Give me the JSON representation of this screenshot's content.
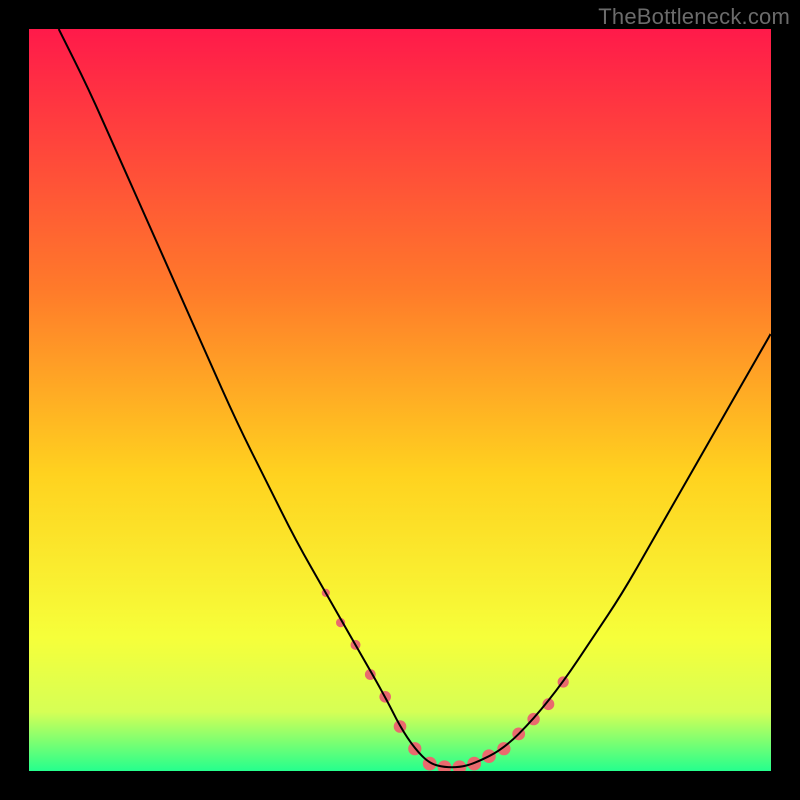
{
  "watermark": "TheBottleneck.com",
  "chart_data": {
    "type": "line",
    "title": "",
    "xlabel": "",
    "ylabel": "",
    "xlim": [
      0,
      100
    ],
    "ylim": [
      0,
      100
    ],
    "grid": false,
    "legend": false,
    "background_gradient": {
      "stops": [
        {
          "offset": 0.0,
          "color": "#ff1a4a"
        },
        {
          "offset": 0.35,
          "color": "#ff7a2a"
        },
        {
          "offset": 0.6,
          "color": "#ffd21f"
        },
        {
          "offset": 0.82,
          "color": "#f6ff3a"
        },
        {
          "offset": 0.92,
          "color": "#d6ff55"
        },
        {
          "offset": 1.0,
          "color": "#25ff8d"
        }
      ]
    },
    "series": [
      {
        "name": "bottleneck-curve",
        "stroke": "#000000",
        "x": [
          4,
          8,
          12,
          16,
          20,
          24,
          28,
          32,
          36,
          40,
          44,
          48,
          50,
          52,
          54,
          56,
          58,
          60,
          64,
          68,
          72,
          76,
          80,
          84,
          88,
          92,
          96,
          100
        ],
        "y": [
          100,
          92,
          83,
          74,
          65,
          56,
          47,
          39,
          31,
          24,
          17,
          10,
          6,
          3,
          1,
          0.5,
          0.5,
          1,
          3,
          7,
          12,
          18,
          24,
          31,
          38,
          45,
          52,
          59
        ]
      }
    ],
    "highlight_dots": {
      "color": "#e96a6e",
      "radius_range": [
        4,
        7
      ],
      "x": [
        40,
        42,
        44,
        46,
        48,
        50,
        52,
        54,
        56,
        58,
        60,
        62,
        64,
        66,
        68,
        70,
        72
      ],
      "y": [
        24,
        20,
        17,
        13,
        10,
        6,
        3,
        1,
        0.5,
        0.5,
        1,
        2,
        3,
        5,
        7,
        9,
        12
      ]
    }
  }
}
